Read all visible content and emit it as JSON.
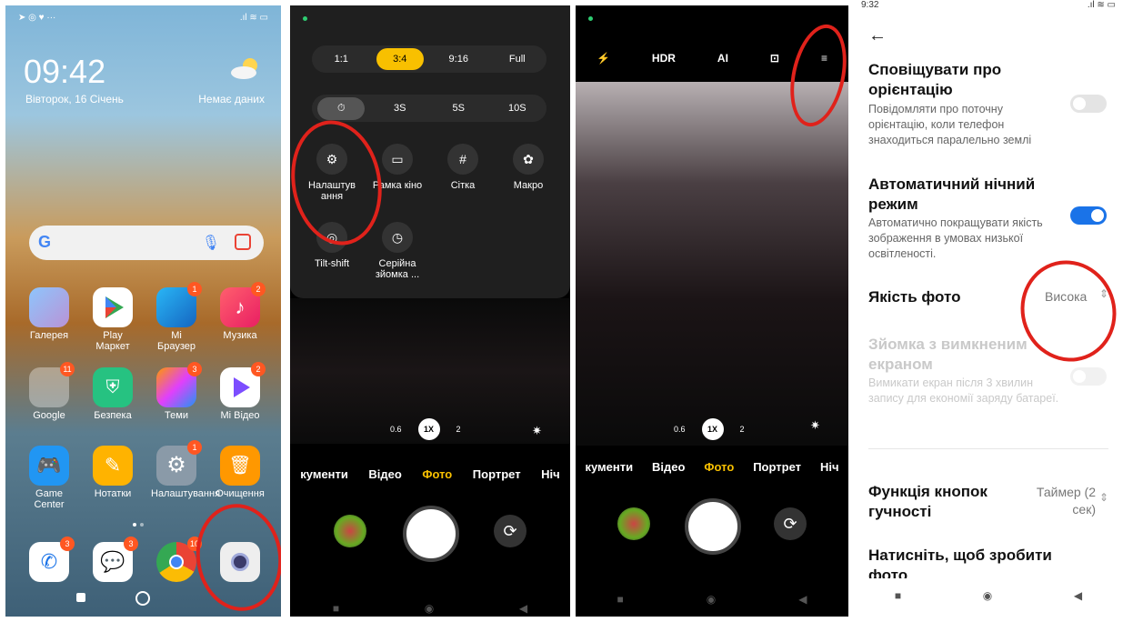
{
  "panel1": {
    "clock": "09:42",
    "date": "Вівторок, 16 Січень",
    "weather": "Немає даних",
    "apps_row1": [
      {
        "label": "Галерея",
        "icon": "gallery-icon",
        "badge": ""
      },
      {
        "label": "Play Маркет",
        "icon": "play-store-icon",
        "badge": ""
      },
      {
        "label": "Mi Браузер",
        "icon": "browser-icon",
        "badge": "1"
      },
      {
        "label": "Музика",
        "icon": "music-icon",
        "badge": "2"
      }
    ],
    "apps_row2": [
      {
        "label": "Google",
        "icon": "google-folder-icon",
        "badge": "11"
      },
      {
        "label": "Безпека",
        "icon": "security-icon",
        "badge": ""
      },
      {
        "label": "Теми",
        "icon": "themes-icon",
        "badge": "3"
      },
      {
        "label": "Mi Відео",
        "icon": "video-icon",
        "badge": "2"
      }
    ],
    "apps_row3": [
      {
        "label": "Game Center",
        "icon": "gamepad-icon",
        "badge": ""
      },
      {
        "label": "Нотатки",
        "icon": "notes-icon",
        "badge": ""
      },
      {
        "label": "Налаштування",
        "icon": "settings-icon",
        "badge": "1"
      },
      {
        "label": "Очищення",
        "icon": "cleaner-icon",
        "badge": ""
      }
    ],
    "dock_badges": [
      "3",
      "3",
      "10",
      ""
    ],
    "colors": {
      "badge": "#ff5722",
      "annotation": "#e0221b"
    }
  },
  "panel2": {
    "aspect_options": [
      "1:1",
      "3:4",
      "9:16",
      "Full"
    ],
    "aspect_selected": "3:4",
    "timer_options": [
      "⏱",
      "3S",
      "5S",
      "10S"
    ],
    "grid_items": [
      {
        "label": "Налаштув ання",
        "icon": "settings-gear-icon"
      },
      {
        "label": "Рамка кіно",
        "icon": "frame-icon"
      },
      {
        "label": "Сітка",
        "icon": "grid-icon"
      },
      {
        "label": "Макро",
        "icon": "macro-icon"
      },
      {
        "label": "Tilt-shift",
        "icon": "tilt-shift-icon"
      },
      {
        "label": "Серійна зйомка ...",
        "icon": "burst-icon"
      }
    ],
    "zoom": [
      "0.6",
      "1X",
      "2"
    ],
    "modes": [
      "кументи",
      "Відео",
      "Фото",
      "Портрет",
      "Ніч"
    ],
    "active_mode": "Фото"
  },
  "panel3": {
    "toolbar": [
      "HDR",
      "AI"
    ],
    "zoom": [
      "0.6",
      "1X",
      "2"
    ],
    "modes": [
      "кументи",
      "Відео",
      "Фото",
      "Портрет",
      "Ніч"
    ],
    "active_mode": "Фото"
  },
  "panel4": {
    "status_time": "9:32",
    "settings": [
      {
        "title": "Сповіщувати про орієнтацію",
        "desc": "Повідомляти про поточну орієнтацію, коли телефон знаходиться паралельно землі",
        "enabled": false,
        "dimmed": false
      },
      {
        "title": "Автоматичний нічний режим",
        "desc": "Автоматично покращувати якість зображення в умовах низької освітленості.",
        "enabled": true,
        "dimmed": false
      },
      {
        "title": "Якість фото",
        "value": "Висока"
      },
      {
        "title": "Зйомка з вимкненим екраном",
        "desc": "Вимикати екран після 3 хвилин запису для економії заряду батареї.",
        "enabled": false,
        "dimmed": true
      },
      {
        "title": "Функція кнопок гучності",
        "value": "Таймер (2 сек)"
      },
      {
        "title": "Натисніть, щоб зробити фото"
      }
    ],
    "colors": {
      "toggle_on": "#1a73e8",
      "toggle_off": "#e4e4e4"
    }
  }
}
